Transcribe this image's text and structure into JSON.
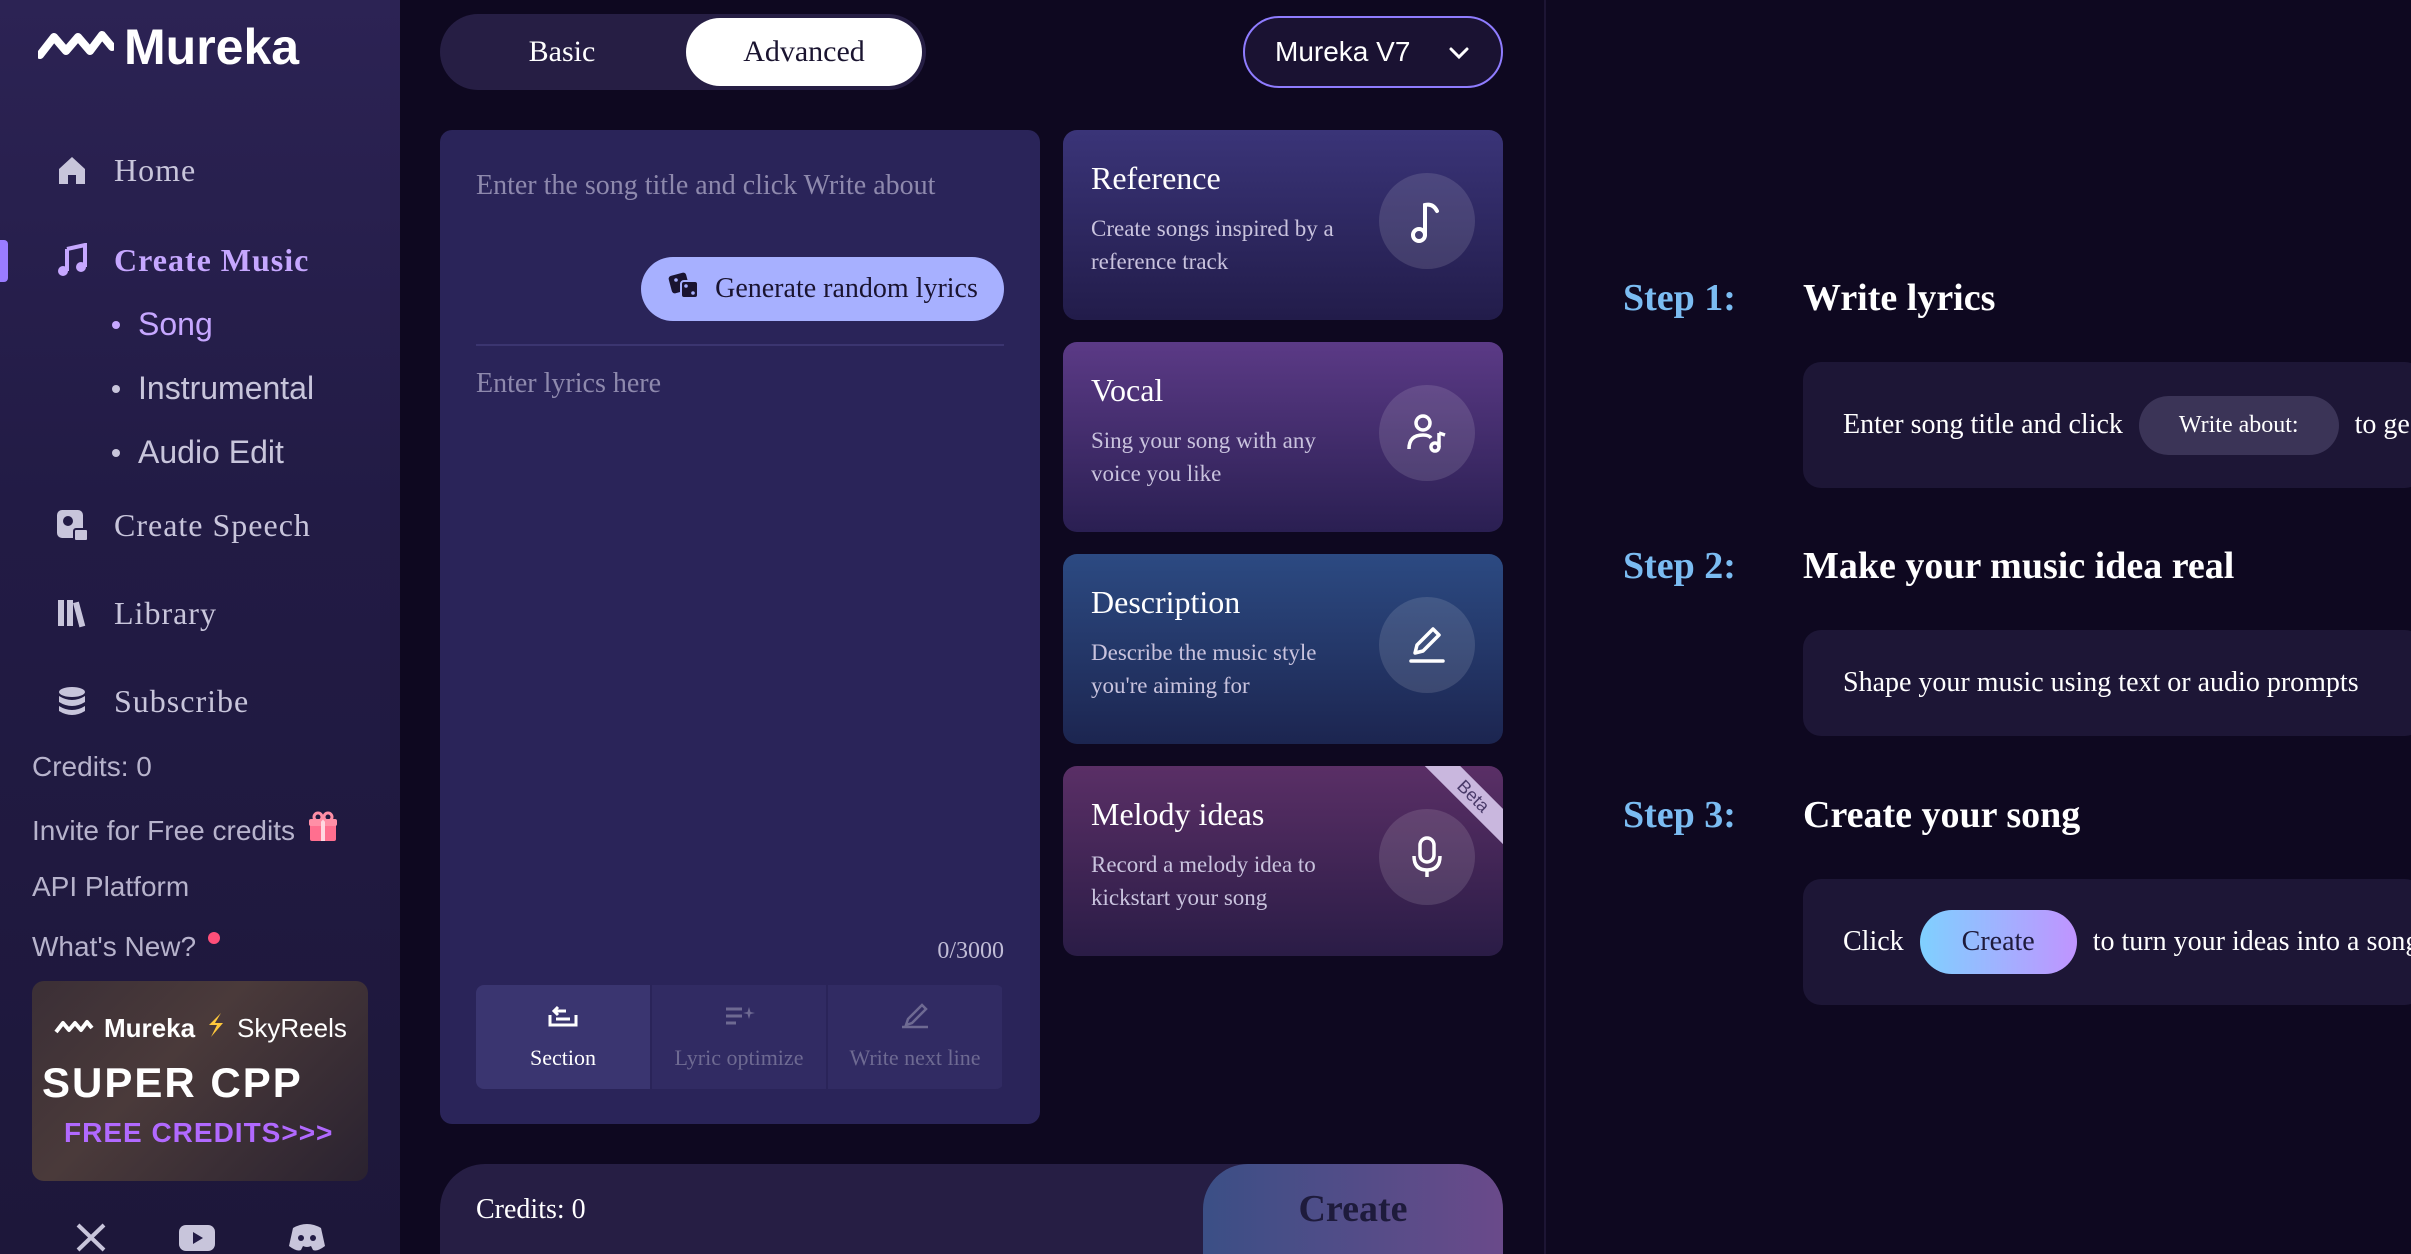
{
  "app": {
    "name": "Mureka"
  },
  "sidebar": {
    "nav": [
      {
        "label": "Home",
        "icon": "home-icon"
      },
      {
        "label": "Create Music",
        "icon": "music-note-icon",
        "active": true
      },
      {
        "label": "Create Speech",
        "icon": "speech-icon"
      },
      {
        "label": "Library",
        "icon": "library-icon"
      },
      {
        "label": "Subscribe",
        "icon": "coins-icon"
      }
    ],
    "sub": [
      "Song",
      "Instrumental",
      "Audio Edit"
    ],
    "credits": "Credits: 0",
    "invite": "Invite for Free credits",
    "api": "API Platform",
    "whats_new": "What's New?",
    "promo": {
      "brand1": "Mureka",
      "brand2": "SkyReels",
      "title": "SUPER CPP",
      "subtitle": "FREE CREDITS>>>"
    }
  },
  "mode": {
    "basic": "Basic",
    "advanced": "Advanced",
    "selected": "Advanced"
  },
  "model": {
    "selected": "Mureka V7"
  },
  "lyrics": {
    "title_placeholder": "Enter the song title and click Write about",
    "generate_label": "Generate random lyrics",
    "lyrics_placeholder": "Enter lyrics here",
    "count": "0/3000",
    "tools": [
      "Section",
      "Lyric optimize",
      "Write next line"
    ]
  },
  "cards": [
    {
      "title": "Reference",
      "desc": "Create songs inspired by a reference track",
      "icon": "music-note-icon"
    },
    {
      "title": "Vocal",
      "desc": "Sing your song with any voice you like",
      "icon": "voice-user-icon"
    },
    {
      "title": "Description",
      "desc": "Describe the music style you're aiming for",
      "icon": "pencil-icon"
    },
    {
      "title": "Melody ideas",
      "desc": "Record a melody idea to kickstart your song",
      "icon": "microphone-icon",
      "badge": "Beta"
    }
  ],
  "bottom": {
    "credits": "Credits: 0",
    "create": "Create"
  },
  "steps": [
    {
      "label": "Step 1:",
      "title": "Write lyrics",
      "text_before": "Enter song title and click",
      "pill": "Write about:",
      "text_after": "to ge"
    },
    {
      "label": "Step 2:",
      "title": "Make your music idea real",
      "text": "Shape your music using text or audio prompts"
    },
    {
      "label": "Step 3:",
      "title": "Create your song",
      "text_before": "Click",
      "pill": "Create",
      "text_after": "to turn your ideas into a song"
    }
  ],
  "colors": {
    "accent": "#c6a7ff",
    "step_label": "#7bbcf2",
    "gen_button": "#a7b0ff"
  }
}
